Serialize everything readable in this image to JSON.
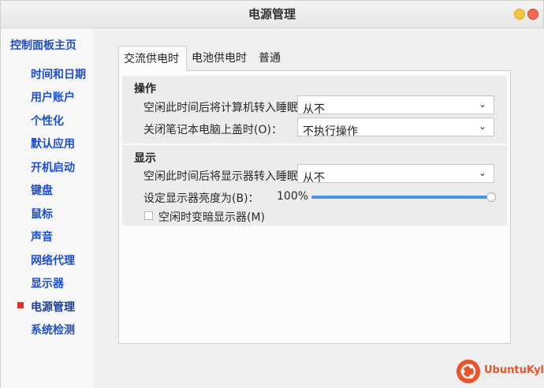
{
  "window": {
    "title": "电源管理"
  },
  "sidebar": {
    "home_label": "控制面板主页",
    "items": [
      {
        "label": "时间和日期"
      },
      {
        "label": "用户账户"
      },
      {
        "label": "个性化"
      },
      {
        "label": "默认应用"
      },
      {
        "label": "开机启动"
      },
      {
        "label": "键盘"
      },
      {
        "label": "鼠标"
      },
      {
        "label": "声音"
      },
      {
        "label": "网络代理"
      },
      {
        "label": "显示器"
      },
      {
        "label": "电源管理",
        "active": true
      },
      {
        "label": "系统检测"
      }
    ]
  },
  "tabs": [
    {
      "label": "交流供电时",
      "selected": true
    },
    {
      "label": "电池供电时",
      "selected": false
    },
    {
      "label": "普通",
      "selected": false
    }
  ],
  "operation": {
    "title": "操作",
    "idle_sleep_label": "空闲此时间后将计算机转入睡眠",
    "idle_sleep_value": "从不",
    "lid_close_label": "关闭笔记本电脑上盖时(O)：",
    "lid_close_value": "不执行操作"
  },
  "display": {
    "title": "显示",
    "idle_display_label": "空闲此时间后将显示器转入睡眠",
    "idle_display_value": "从不",
    "brightness_label": "设定显示器亮度为(B)：",
    "brightness_value": "100%",
    "brightness_level": 1.0,
    "dim_label": "空闲时变暗显示器(M)",
    "dim_checked": false
  },
  "brand": {
    "name": "UbuntuKylin",
    "color": "#e9542b"
  },
  "colors": {
    "accent": "#4a90e2",
    "link": "#1d4fcf",
    "active_marker": "#d9322a"
  }
}
